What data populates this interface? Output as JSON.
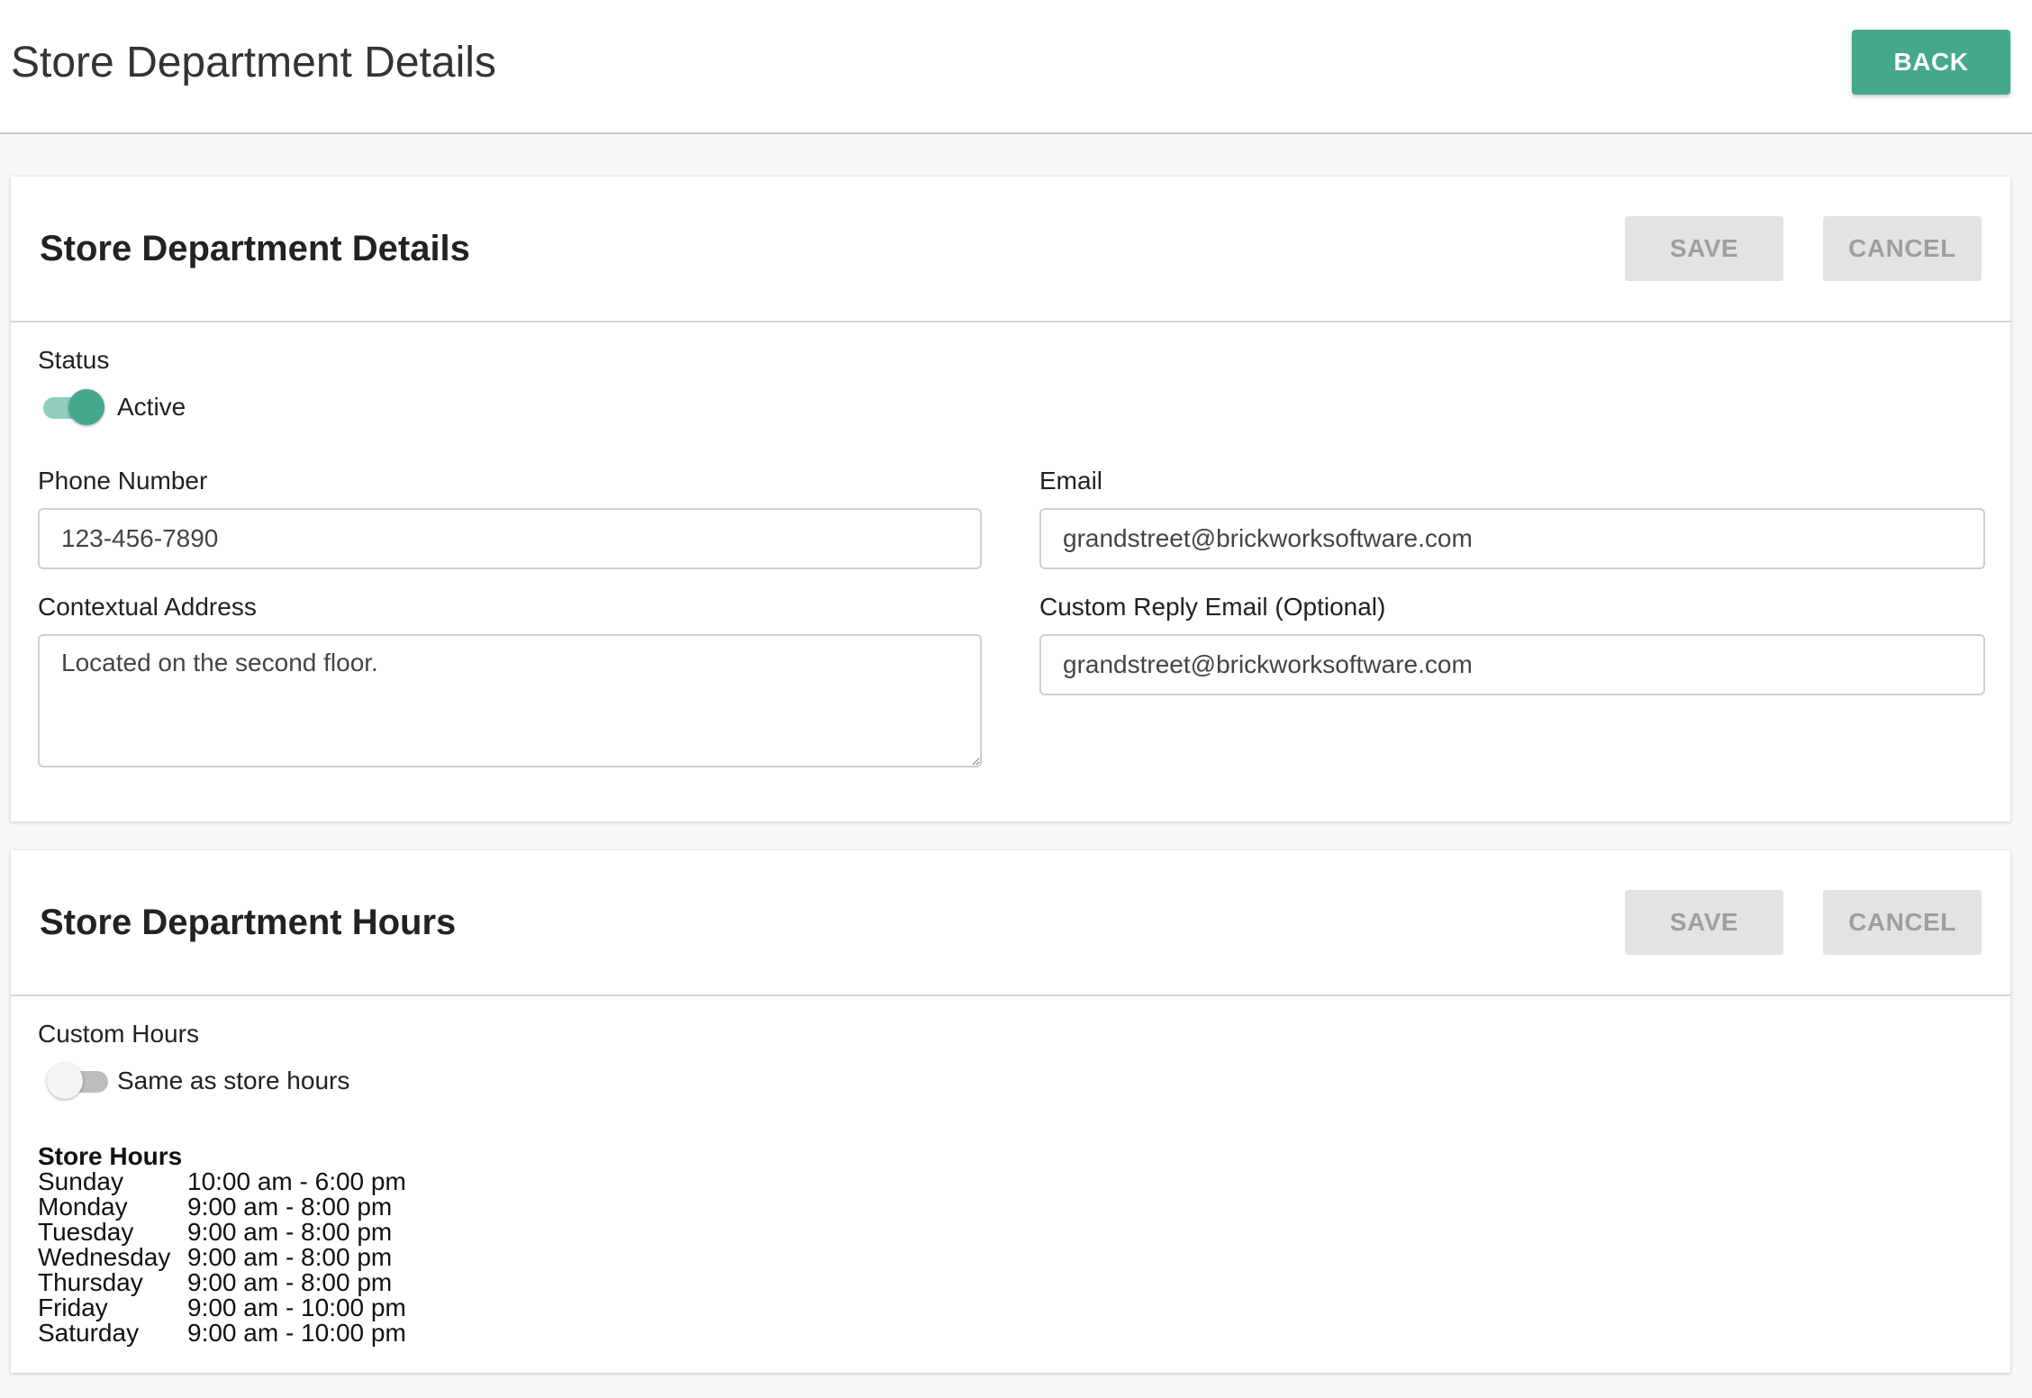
{
  "header": {
    "title": "Store Department Details",
    "back_label": "BACK"
  },
  "details_card": {
    "title": "Store Department Details",
    "save_label": "SAVE",
    "cancel_label": "CANCEL",
    "status_label": "Status",
    "status_value": "Active",
    "status_on": true,
    "phone_label": "Phone Number",
    "phone_value": "123-456-7890",
    "email_label": "Email",
    "email_value": "grandstreet@brickworksoftware.com",
    "address_label": "Contextual Address",
    "address_value": "Located on the second floor.",
    "reply_email_label": "Custom Reply Email (Optional)",
    "reply_email_value": "grandstreet@brickworksoftware.com"
  },
  "hours_card": {
    "title": "Store Department Hours",
    "save_label": "SAVE",
    "cancel_label": "CANCEL",
    "custom_hours_label": "Custom Hours",
    "custom_hours_toggle_label": "Same as store hours",
    "custom_hours_on": false,
    "store_hours_heading": "Store Hours",
    "store_hours": [
      {
        "day": "Sunday",
        "hours": "10:00 am - 6:00 pm"
      },
      {
        "day": "Monday",
        "hours": "9:00 am - 8:00 pm"
      },
      {
        "day": "Tuesday",
        "hours": "9:00 am - 8:00 pm"
      },
      {
        "day": "Wednesday",
        "hours": "9:00 am - 8:00 pm"
      },
      {
        "day": "Thursday",
        "hours": "9:00 am - 8:00 pm"
      },
      {
        "day": "Friday",
        "hours": "9:00 am - 10:00 pm"
      },
      {
        "day": "Saturday",
        "hours": "9:00 am - 10:00 pm"
      }
    ]
  },
  "colors": {
    "accent": "#45a88c",
    "disabled_button": "#e3e3e3"
  }
}
